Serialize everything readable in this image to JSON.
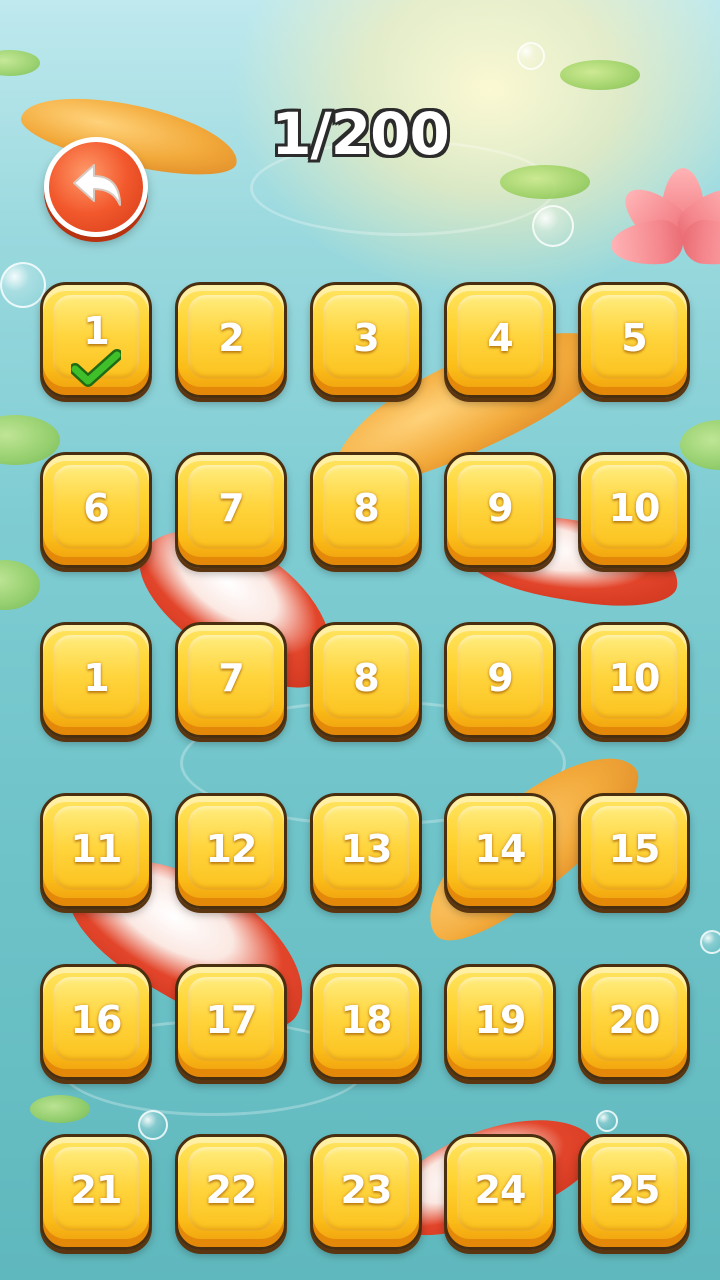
{
  "header": {
    "progress_text": "1/200"
  },
  "back_button": {
    "icon": "back-arrow-icon"
  },
  "levels": [
    {
      "label": "1",
      "completed": true
    },
    {
      "label": "2",
      "completed": false
    },
    {
      "label": "3",
      "completed": false
    },
    {
      "label": "4",
      "completed": false
    },
    {
      "label": "5",
      "completed": false
    },
    {
      "label": "6",
      "completed": false
    },
    {
      "label": "7",
      "completed": false
    },
    {
      "label": "8",
      "completed": false
    },
    {
      "label": "9",
      "completed": false
    },
    {
      "label": "10",
      "completed": false
    },
    {
      "label": "1",
      "completed": false
    },
    {
      "label": "7",
      "completed": false
    },
    {
      "label": "8",
      "completed": false
    },
    {
      "label": "9",
      "completed": false
    },
    {
      "label": "10",
      "completed": false
    },
    {
      "label": "11",
      "completed": false
    },
    {
      "label": "12",
      "completed": false
    },
    {
      "label": "13",
      "completed": false
    },
    {
      "label": "14",
      "completed": false
    },
    {
      "label": "15",
      "completed": false
    },
    {
      "label": "16",
      "completed": false
    },
    {
      "label": "17",
      "completed": false
    },
    {
      "label": "18",
      "completed": false
    },
    {
      "label": "19",
      "completed": false
    },
    {
      "label": "20",
      "completed": false
    },
    {
      "label": "21",
      "completed": false
    },
    {
      "label": "22",
      "completed": false
    },
    {
      "label": "23",
      "completed": false
    },
    {
      "label": "24",
      "completed": false
    },
    {
      "label": "25",
      "completed": false
    }
  ],
  "colors": {
    "button_yellow": "#ffd331",
    "button_outline": "#4a2e10",
    "back_button_red": "#f2582c",
    "check_green": "#3fbf2a",
    "water": "#7fcdd3"
  }
}
